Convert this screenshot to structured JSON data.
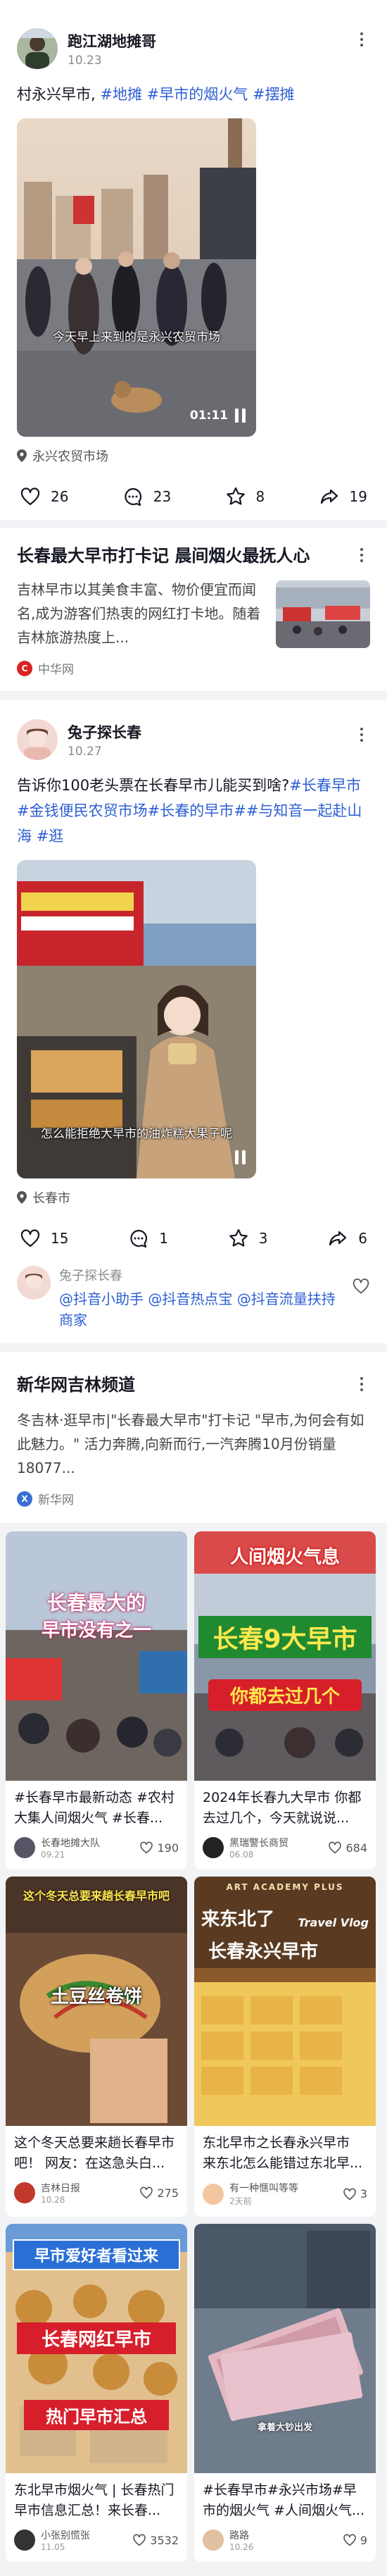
{
  "post1": {
    "author": "跑江湖地摊哥",
    "date": "10.23",
    "text_plain": "村永兴早市, ",
    "tags": [
      "#地摊",
      "#早市的烟火气",
      "#摆摊"
    ],
    "subtitle": "今天早上来到的是永兴农贸市场",
    "duration": "01:11",
    "location": "永兴农贸市场",
    "likes": "26",
    "comments": "23",
    "favorites": "8",
    "shares": "19"
  },
  "article1": {
    "title": "长春最大早市打卡记 晨间烟火最抚人心",
    "body": "吉林早市以其美食丰富、物价便宜而闻名,成为游客们热衷的网红打卡地。随着吉林旅游热度上...",
    "source": "中华网"
  },
  "post2": {
    "author": "兔子探长春",
    "date": "10.27",
    "text_plain": "告诉你100老头票在长春早市儿能买到啥?",
    "tags": [
      "#长春早市",
      "#金钱便民农贸市场",
      "#长春的早市",
      "#",
      "#与知音一起赴山海",
      "#逛"
    ],
    "subtitle": "怎么能拒绝大早市的油炸糕大果子呢",
    "location": "长春市",
    "likes": "15",
    "comments": "1",
    "favorites": "3",
    "shares": "6",
    "comment": {
      "user": "兔子探长春",
      "text": "@抖音小助手 @抖音热点宝 @抖音流量扶持商家"
    }
  },
  "article2": {
    "title": "新华网吉林频道",
    "body": "冬吉林·逛早市|\"长春最大早市\"打卡记 \"早市,为何会有如此魅力。\" 活力奔腾,向新而行,一汽奔腾10月份销量18077...",
    "source": "新华网"
  },
  "grid": [
    {
      "title": "#长春早市最新动态 #农村大集人间烟火气 #长春...",
      "user": "长春地摊大队",
      "date": "09.21",
      "likes": "190",
      "overlay": [
        "长春最大的",
        "早市没有之一"
      ]
    },
    {
      "title": "2024年长春九大早市 你都去过几个，今天就说说...",
      "user": "黑瑞警长商贸",
      "date": "06.08",
      "likes": "684",
      "overlay": [
        "人间烟火气息",
        "长春9大早市",
        "你都去过几个"
      ]
    },
    {
      "title": "这个冬天总要来趟长春早市吧！ 网友：在这急头白...",
      "user": "吉林日报",
      "date": "10.28",
      "likes": "275",
      "overlay": [
        "这个冬天总要来趟长春早市吧",
        "土豆丝卷饼"
      ]
    },
    {
      "title": "东北早市之长春永兴早市 来东北怎么能错过东北早...",
      "user": "有一种惬叫等等",
      "date": "2天前",
      "likes": "3",
      "overlay": [
        "来东北了",
        "长春永兴早市",
        "Travel Vlog",
        "ART ACADEMY PLUS"
      ]
    },
    {
      "title": "东北早市烟火气 | 长春热门早市信息汇总！来长春...",
      "user": "小张别慌张",
      "date": "11.05",
      "likes": "3532",
      "overlay": [
        "早市爱好者看过来",
        "长春网红早市",
        "热门早市汇总"
      ]
    },
    {
      "title": "#长春早市#永兴市场#早市的烟火气 #人间烟火气...",
      "user": "路路",
      "date": "10.26",
      "likes": "9",
      "overlay": [
        "拿着大钞出发"
      ]
    }
  ],
  "colors": {
    "tag": "#2d5fd3",
    "text": "#161823",
    "muted": "#8a8b91",
    "background": "#f2f3f5"
  }
}
